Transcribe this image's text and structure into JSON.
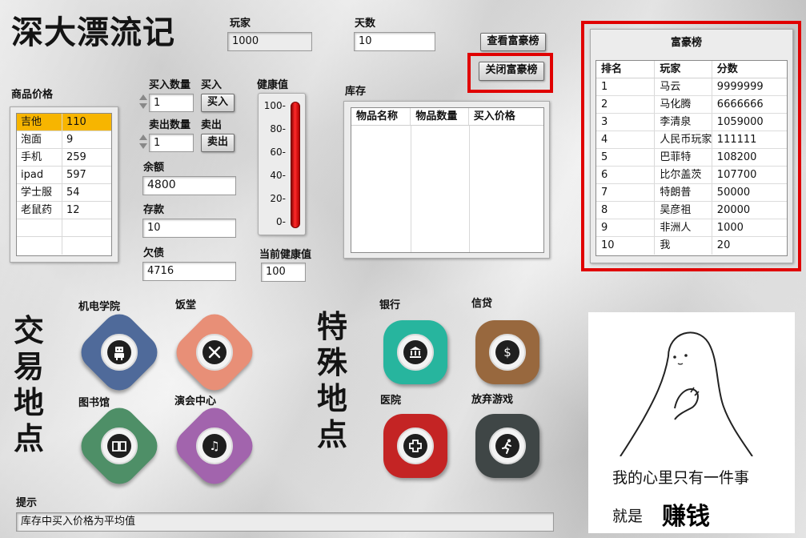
{
  "app_title": "深大漂流记",
  "player": {
    "label": "玩家",
    "value": "1000"
  },
  "days": {
    "label": "天数",
    "value": "10"
  },
  "buttons": {
    "view_ranking": "查看富豪榜",
    "close_ranking": "关闭富豪榜",
    "buy": "买入",
    "sell": "卖出"
  },
  "goods": {
    "title": "商品价格",
    "items": [
      {
        "name": "吉他",
        "price": "110"
      },
      {
        "name": "泡面",
        "price": "9"
      },
      {
        "name": "手机",
        "price": "259"
      },
      {
        "name": "ipad",
        "price": "597"
      },
      {
        "name": "学士服",
        "price": "54"
      },
      {
        "name": "老鼠药",
        "price": "12"
      }
    ]
  },
  "trade": {
    "buy_qty_label": "买入数量",
    "buy_qty": "1",
    "buy_label": "买入",
    "sell_qty_label": "卖出数量",
    "sell_qty": "1",
    "sell_label": "卖出"
  },
  "balance": {
    "label": "余额",
    "value": "4800"
  },
  "deposit": {
    "label": "存款",
    "value": "10"
  },
  "debt": {
    "label": "欠债",
    "value": "4716"
  },
  "health": {
    "label": "健康值",
    "ticks": [
      "100-",
      "80-",
      "60-",
      "40-",
      "20-",
      "0-"
    ],
    "level": 100,
    "current_label": "当前健康值",
    "current_value": "100"
  },
  "inventory": {
    "title": "库存",
    "columns": [
      "物品名称",
      "物品数量",
      "买入价格"
    ],
    "rows": []
  },
  "ranking": {
    "title": "富豪榜",
    "columns": [
      "排名",
      "玩家",
      "分数"
    ],
    "rows": [
      [
        "1",
        "马云",
        "9999999"
      ],
      [
        "2",
        "马化腾",
        "6666666"
      ],
      [
        "3",
        "李清泉",
        "1059000"
      ],
      [
        "4",
        "人民币玩家",
        "111111"
      ],
      [
        "5",
        "巴菲特",
        "108200"
      ],
      [
        "6",
        "比尔盖茨",
        "107700"
      ],
      [
        "7",
        "特朗普",
        "50000"
      ],
      [
        "8",
        "吴彦祖",
        "20000"
      ],
      [
        "9",
        "非洲人",
        "1000"
      ],
      [
        "10",
        "我",
        "20"
      ]
    ]
  },
  "trade_places": {
    "title": [
      "交",
      "易",
      "地",
      "点"
    ],
    "items": [
      {
        "label": "机电学院",
        "icon": "robot-icon",
        "color": "#4f6a9a"
      },
      {
        "label": "饭堂",
        "icon": "fork-knife-icon",
        "color": "#e88f77"
      },
      {
        "label": "图书馆",
        "icon": "book-icon",
        "color": "#4e8f67"
      },
      {
        "label": "演会中心",
        "icon": "music-note-icon",
        "color": "#a264ad"
      }
    ]
  },
  "special_places": {
    "title": [
      "特",
      "殊",
      "地",
      "点"
    ],
    "items": [
      {
        "label": "银行",
        "icon": "bank-icon",
        "color": "#27b59e"
      },
      {
        "label": "信贷",
        "icon": "money-hand-icon",
        "color": "#98683e"
      },
      {
        "label": "医院",
        "icon": "medical-cross-icon",
        "color": "#c42424"
      },
      {
        "label": "放弃游戏",
        "icon": "running-man-icon",
        "color": "#3f4646"
      }
    ]
  },
  "hint": {
    "label": "提示",
    "text": "库存中买入价格为平均值"
  },
  "meme": {
    "line1": "我的心里只有一件事",
    "line2_prefix": "就是",
    "line2_bold": "赚钱"
  }
}
